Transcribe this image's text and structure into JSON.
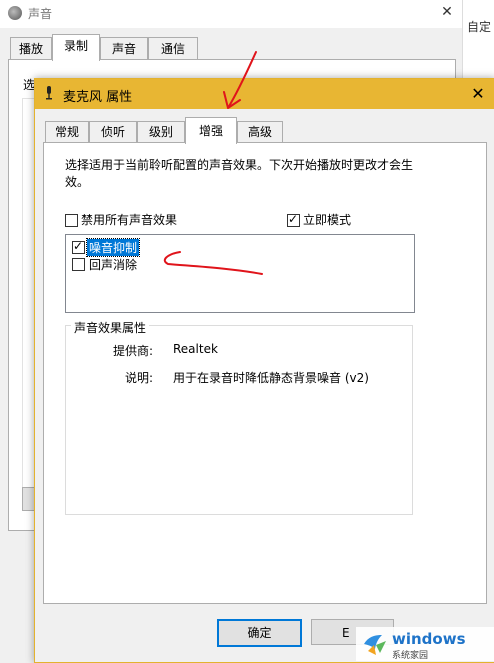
{
  "background_window": {
    "title": "声音",
    "right_strip_text": "自定",
    "tabs": [
      {
        "label": "播放"
      },
      {
        "label": "录制"
      },
      {
        "label": "声音"
      },
      {
        "label": "通信"
      }
    ],
    "selected_tab": "录制",
    "panel_label_fragment": "选"
  },
  "dialog": {
    "title": "麦克风 属性",
    "tabs": [
      {
        "label": "常规"
      },
      {
        "label": "侦听"
      },
      {
        "label": "级别"
      },
      {
        "label": "增强"
      },
      {
        "label": "高级"
      }
    ],
    "selected_tab": "增强",
    "description_line1": "选择适用于当前聆听配置的声音效果。下次开始播放时更改才会生",
    "description_line2": "效。",
    "disable_all_label": "禁用所有声音效果",
    "disable_all_checked": false,
    "immediate_mode_label": "立即模式",
    "immediate_mode_checked": true,
    "effects": [
      {
        "label": "噪音抑制",
        "checked": true,
        "selected": true
      },
      {
        "label": "回声消除",
        "checked": false,
        "selected": false
      }
    ],
    "properties_title": "声音效果属性",
    "provider_key": "提供商:",
    "provider_value": "Realtek",
    "description_key": "说明:",
    "description_value": "用于在录音时降低静态背景噪音 (v2)",
    "ok_label": "确定",
    "cancel_label_fragment": "E"
  },
  "watermark": {
    "brand": "windows",
    "subtitle": "系统家园"
  },
  "colors": {
    "title_bar_accent": "#e8b633",
    "selection_blue": "#0078d7",
    "annotation_red": "#e0141b"
  }
}
